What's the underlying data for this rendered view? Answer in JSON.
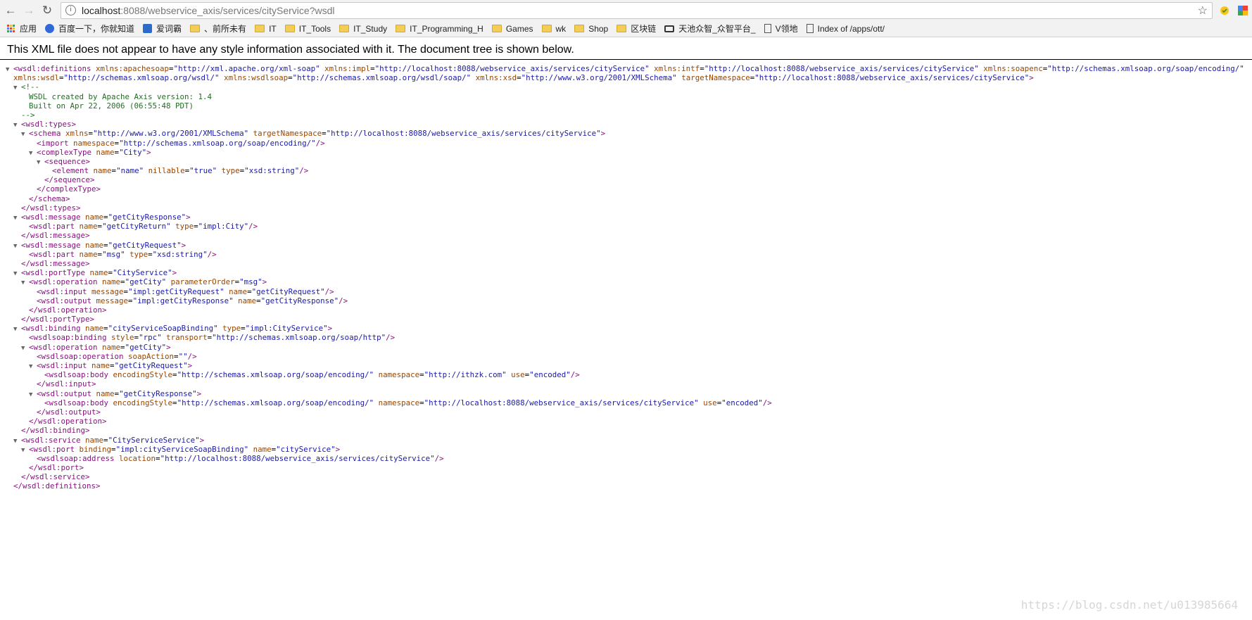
{
  "browser": {
    "url_host": "localhost",
    "url_path": ":8088/webservice_axis/services/cityService?wsdl",
    "bookmarks": [
      {
        "label": "应用",
        "kind": "apps"
      },
      {
        "label": "百度一下，你就知道",
        "kind": "paw"
      },
      {
        "label": "爱词霸",
        "kind": "ciba"
      },
      {
        "label": "、前所未有",
        "kind": "folder"
      },
      {
        "label": "IT",
        "kind": "folder"
      },
      {
        "label": "IT_Tools",
        "kind": "folder"
      },
      {
        "label": "IT_Study",
        "kind": "folder"
      },
      {
        "label": "IT_Programming_H",
        "kind": "folder"
      },
      {
        "label": "Games",
        "kind": "folder"
      },
      {
        "label": "wk",
        "kind": "folder"
      },
      {
        "label": "Shop",
        "kind": "folder"
      },
      {
        "label": "区块链",
        "kind": "folder"
      },
      {
        "label": "天池众智_众智平台_",
        "kind": "tianchi"
      },
      {
        "label": "V领地",
        "kind": "page"
      },
      {
        "label": "Index of /apps/ott/",
        "kind": "page"
      }
    ]
  },
  "viewer": {
    "notice": "This XML file does not appear to have any style information associated with it. The document tree is shown below."
  },
  "xml_lines": [
    {
      "i": 0,
      "t": "v",
      "h": "<span class=tg>&lt;wsdl:definitions</span> <span class=an>xmlns:apachesoap</span>=<span class=av>\"http://xml.apache.org/xml-soap\"</span> <span class=an>xmlns:impl</span>=<span class=av>\"http://localhost:8088/webservice_axis/services/cityService\"</span> <span class=an>xmlns:intf</span>=<span class=av>\"http://localhost:8088/webservice_axis/services/cityService\"</span> <span class=an>xmlns:soapenc</span>=<span class=av>\"http://schemas.xmlsoap.org/soap/encoding/\"</span>"
    },
    {
      "i": 0,
      "t": "",
      "h": "<span class=an>xmlns:wsdl</span>=<span class=av>\"http://schemas.xmlsoap.org/wsdl/\"</span> <span class=an>xmlns:wsdlsoap</span>=<span class=av>\"http://schemas.xmlsoap.org/wsdl/soap/\"</span> <span class=an>xmlns:xsd</span>=<span class=av>\"http://www.w3.org/2001/XMLSchema\"</span> <span class=an>targetNamespace</span>=<span class=av>\"http://localhost:8088/webservice_axis/services/cityService\"</span><span class=tg>&gt;</span>"
    },
    {
      "i": 1,
      "t": "v",
      "h": "<span class=cm>&lt;!--</span>"
    },
    {
      "i": 2,
      "t": "",
      "h": "<span class=cm>WSDL created by Apache Axis version: 1.4</span>"
    },
    {
      "i": 2,
      "t": "",
      "h": "<span class=cm>Built on Apr 22, 2006 (06:55:48 PDT)</span>"
    },
    {
      "i": 1,
      "t": "",
      "h": "<span class=cm>--&gt;</span>"
    },
    {
      "i": 1,
      "t": "v",
      "h": "<span class=tg>&lt;wsdl:types&gt;</span>"
    },
    {
      "i": 2,
      "t": "v",
      "h": "<span class=tg>&lt;schema</span> <span class=an>xmlns</span>=<span class=av>\"http://www.w3.org/2001/XMLSchema\"</span> <span class=an>targetNamespace</span>=<span class=av>\"http://localhost:8088/webservice_axis/services/cityService\"</span><span class=tg>&gt;</span>"
    },
    {
      "i": 3,
      "t": "",
      "h": "<span class=tg>&lt;import</span> <span class=an>namespace</span>=<span class=av>\"http://schemas.xmlsoap.org/soap/encoding/\"</span><span class=tg>/&gt;</span>"
    },
    {
      "i": 3,
      "t": "v",
      "h": "<span class=tg>&lt;complexType</span> <span class=an>name</span>=<span class=av>\"City\"</span><span class=tg>&gt;</span>"
    },
    {
      "i": 4,
      "t": "v",
      "h": "<span class=tg>&lt;sequence&gt;</span>"
    },
    {
      "i": 5,
      "t": "",
      "h": "<span class=tg>&lt;element</span> <span class=an>name</span>=<span class=av>\"name\"</span> <span class=an>nillable</span>=<span class=av>\"true\"</span> <span class=an>type</span>=<span class=av>\"xsd:string\"</span><span class=tg>/&gt;</span>"
    },
    {
      "i": 4,
      "t": "",
      "h": "<span class=tg>&lt;/sequence&gt;</span>"
    },
    {
      "i": 3,
      "t": "",
      "h": "<span class=tg>&lt;/complexType&gt;</span>"
    },
    {
      "i": 2,
      "t": "",
      "h": "<span class=tg>&lt;/schema&gt;</span>"
    },
    {
      "i": 1,
      "t": "",
      "h": "<span class=tg>&lt;/wsdl:types&gt;</span>"
    },
    {
      "i": 1,
      "t": "v",
      "h": "<span class=tg>&lt;wsdl:message</span> <span class=an>name</span>=<span class=av>\"getCityResponse\"</span><span class=tg>&gt;</span>"
    },
    {
      "i": 2,
      "t": "",
      "h": "<span class=tg>&lt;wsdl:part</span> <span class=an>name</span>=<span class=av>\"getCityReturn\"</span> <span class=an>type</span>=<span class=av>\"impl:City\"</span><span class=tg>/&gt;</span>"
    },
    {
      "i": 1,
      "t": "",
      "h": "<span class=tg>&lt;/wsdl:message&gt;</span>"
    },
    {
      "i": 1,
      "t": "v",
      "h": "<span class=tg>&lt;wsdl:message</span> <span class=an>name</span>=<span class=av>\"getCityRequest\"</span><span class=tg>&gt;</span>"
    },
    {
      "i": 2,
      "t": "",
      "h": "<span class=tg>&lt;wsdl:part</span> <span class=an>name</span>=<span class=av>\"msg\"</span> <span class=an>type</span>=<span class=av>\"xsd:string\"</span><span class=tg>/&gt;</span>"
    },
    {
      "i": 1,
      "t": "",
      "h": "<span class=tg>&lt;/wsdl:message&gt;</span>"
    },
    {
      "i": 1,
      "t": "v",
      "h": "<span class=tg>&lt;wsdl:portType</span> <span class=an>name</span>=<span class=av>\"CityService\"</span><span class=tg>&gt;</span>"
    },
    {
      "i": 2,
      "t": "v",
      "h": "<span class=tg>&lt;wsdl:operation</span> <span class=an>name</span>=<span class=av>\"getCity\"</span> <span class=an>parameterOrder</span>=<span class=av>\"msg\"</span><span class=tg>&gt;</span>"
    },
    {
      "i": 3,
      "t": "",
      "h": "<span class=tg>&lt;wsdl:input</span> <span class=an>message</span>=<span class=av>\"impl:getCityRequest\"</span> <span class=an>name</span>=<span class=av>\"getCityRequest\"</span><span class=tg>/&gt;</span>"
    },
    {
      "i": 3,
      "t": "",
      "h": "<span class=tg>&lt;wsdl:output</span> <span class=an>message</span>=<span class=av>\"impl:getCityResponse\"</span> <span class=an>name</span>=<span class=av>\"getCityResponse\"</span><span class=tg>/&gt;</span>"
    },
    {
      "i": 2,
      "t": "",
      "h": "<span class=tg>&lt;/wsdl:operation&gt;</span>"
    },
    {
      "i": 1,
      "t": "",
      "h": "<span class=tg>&lt;/wsdl:portType&gt;</span>"
    },
    {
      "i": 1,
      "t": "v",
      "h": "<span class=tg>&lt;wsdl:binding</span> <span class=an>name</span>=<span class=av>\"cityServiceSoapBinding\"</span> <span class=an>type</span>=<span class=av>\"impl:CityService\"</span><span class=tg>&gt;</span>"
    },
    {
      "i": 2,
      "t": "",
      "h": "<span class=tg>&lt;wsdlsoap:binding</span> <span class=an>style</span>=<span class=av>\"rpc\"</span> <span class=an>transport</span>=<span class=av>\"http://schemas.xmlsoap.org/soap/http\"</span><span class=tg>/&gt;</span>"
    },
    {
      "i": 2,
      "t": "v",
      "h": "<span class=tg>&lt;wsdl:operation</span> <span class=an>name</span>=<span class=av>\"getCity\"</span><span class=tg>&gt;</span>"
    },
    {
      "i": 3,
      "t": "",
      "h": "<span class=tg>&lt;wsdlsoap:operation</span> <span class=an>soapAction</span>=<span class=av>\"\"</span><span class=tg>/&gt;</span>"
    },
    {
      "i": 3,
      "t": "v",
      "h": "<span class=tg>&lt;wsdl:input</span> <span class=an>name</span>=<span class=av>\"getCityRequest\"</span><span class=tg>&gt;</span>"
    },
    {
      "i": 4,
      "t": "",
      "h": "<span class=tg>&lt;wsdlsoap:body</span> <span class=an>encodingStyle</span>=<span class=av>\"http://schemas.xmlsoap.org/soap/encoding/\"</span> <span class=an>namespace</span>=<span class=av>\"http://ithzk.com\"</span> <span class=an>use</span>=<span class=av>\"encoded\"</span><span class=tg>/&gt;</span>"
    },
    {
      "i": 3,
      "t": "",
      "h": "<span class=tg>&lt;/wsdl:input&gt;</span>"
    },
    {
      "i": 3,
      "t": "v",
      "h": "<span class=tg>&lt;wsdl:output</span> <span class=an>name</span>=<span class=av>\"getCityResponse\"</span><span class=tg>&gt;</span>"
    },
    {
      "i": 4,
      "t": "",
      "h": "<span class=tg>&lt;wsdlsoap:body</span> <span class=an>encodingStyle</span>=<span class=av>\"http://schemas.xmlsoap.org/soap/encoding/\"</span> <span class=an>namespace</span>=<span class=av>\"http://localhost:8088/webservice_axis/services/cityService\"</span> <span class=an>use</span>=<span class=av>\"encoded\"</span><span class=tg>/&gt;</span>"
    },
    {
      "i": 3,
      "t": "",
      "h": "<span class=tg>&lt;/wsdl:output&gt;</span>"
    },
    {
      "i": 2,
      "t": "",
      "h": "<span class=tg>&lt;/wsdl:operation&gt;</span>"
    },
    {
      "i": 1,
      "t": "",
      "h": "<span class=tg>&lt;/wsdl:binding&gt;</span>"
    },
    {
      "i": 1,
      "t": "v",
      "h": "<span class=tg>&lt;wsdl:service</span> <span class=an>name</span>=<span class=av>\"CityServiceService\"</span><span class=tg>&gt;</span>"
    },
    {
      "i": 2,
      "t": "v",
      "h": "<span class=tg>&lt;wsdl:port</span> <span class=an>binding</span>=<span class=av>\"impl:cityServiceSoapBinding\"</span> <span class=an>name</span>=<span class=av>\"cityService\"</span><span class=tg>&gt;</span>"
    },
    {
      "i": 3,
      "t": "",
      "h": "<span class=tg>&lt;wsdlsoap:address</span> <span class=an>location</span>=<span class=av>\"http://localhost:8088/webservice_axis/services/cityService\"</span><span class=tg>/&gt;</span>"
    },
    {
      "i": 2,
      "t": "",
      "h": "<span class=tg>&lt;/wsdl:port&gt;</span>"
    },
    {
      "i": 1,
      "t": "",
      "h": "<span class=tg>&lt;/wsdl:service&gt;</span>"
    },
    {
      "i": 0,
      "t": "",
      "h": "<span class=tg>&lt;/wsdl:definitions&gt;</span>"
    }
  ],
  "watermark": "https://blog.csdn.net/u013985664"
}
